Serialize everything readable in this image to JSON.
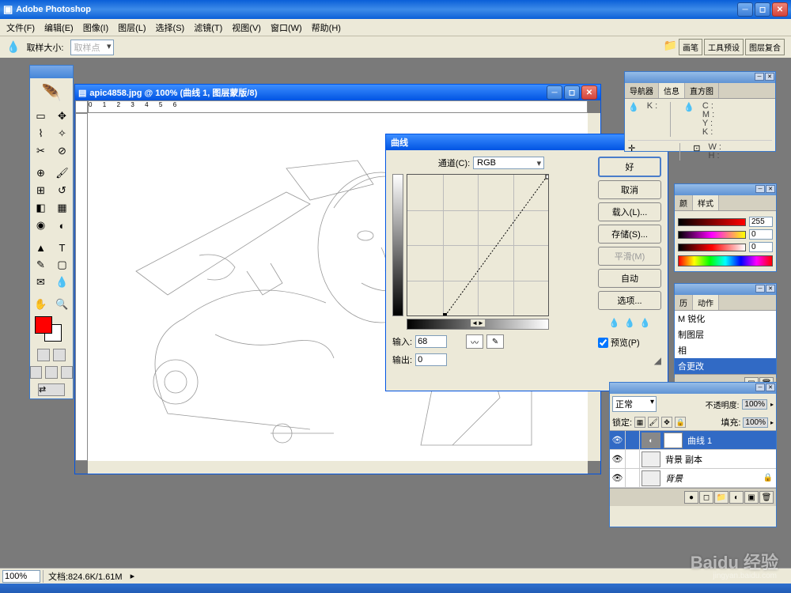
{
  "app": {
    "title": "Adobe Photoshop",
    "icon": "🟦"
  },
  "menu": [
    "文件(F)",
    "编辑(E)",
    "图像(I)",
    "图层(L)",
    "选择(S)",
    "滤镜(T)",
    "视图(V)",
    "窗口(W)",
    "帮助(H)"
  ],
  "options": {
    "sample_label": "取样大小:",
    "sample_value": "取样点",
    "tabs": [
      "画笔",
      "工具预设",
      "图层复合"
    ]
  },
  "document": {
    "title": "apic4858.jpg @ 100% (曲线 1, 图层蒙版/8)"
  },
  "status": {
    "zoom": "100%",
    "doc": "文档:824.6K/1.61M"
  },
  "curves": {
    "title": "曲线",
    "channel_label": "通道(C):",
    "channel_value": "RGB",
    "ok": "好",
    "cancel": "取消",
    "load": "载入(L)...",
    "save": "存储(S)...",
    "smooth": "平滑(M)",
    "auto": "自动",
    "options": "选项...",
    "preview": "预览(P)",
    "input_label": "输入:",
    "input_value": "68",
    "output_label": "输出:",
    "output_value": "0"
  },
  "info_panel": {
    "tabs": [
      "导航器",
      "信息",
      "直方图"
    ],
    "k": "K :",
    "cmyk": [
      "C :",
      "M :",
      "Y :",
      "K :"
    ],
    "wh": [
      "W :",
      "H :"
    ]
  },
  "color_panel": {
    "tabs": [
      "颜",
      "样式"
    ],
    "r": "255",
    "g": "0",
    "b": "0"
  },
  "history_panel": {
    "tabs": [
      "历",
      "动作"
    ],
    "items": [
      "M 锐化",
      "制图层",
      "相",
      "合更改"
    ]
  },
  "layers_panel": {
    "blend": "正常",
    "opacity_label": "不透明度:",
    "opacity_value": "100%",
    "lock_label": "锁定:",
    "fill_label": "填充:",
    "fill_value": "100%",
    "layers": [
      {
        "name": "曲线 1",
        "type": "adjustment"
      },
      {
        "name": "背景 副本",
        "type": "normal"
      },
      {
        "name": "背景",
        "type": "bg",
        "italic": true
      }
    ]
  },
  "watermark": {
    "main": "Baidu 经验",
    "sub": "jingyan.baidu.com"
  }
}
